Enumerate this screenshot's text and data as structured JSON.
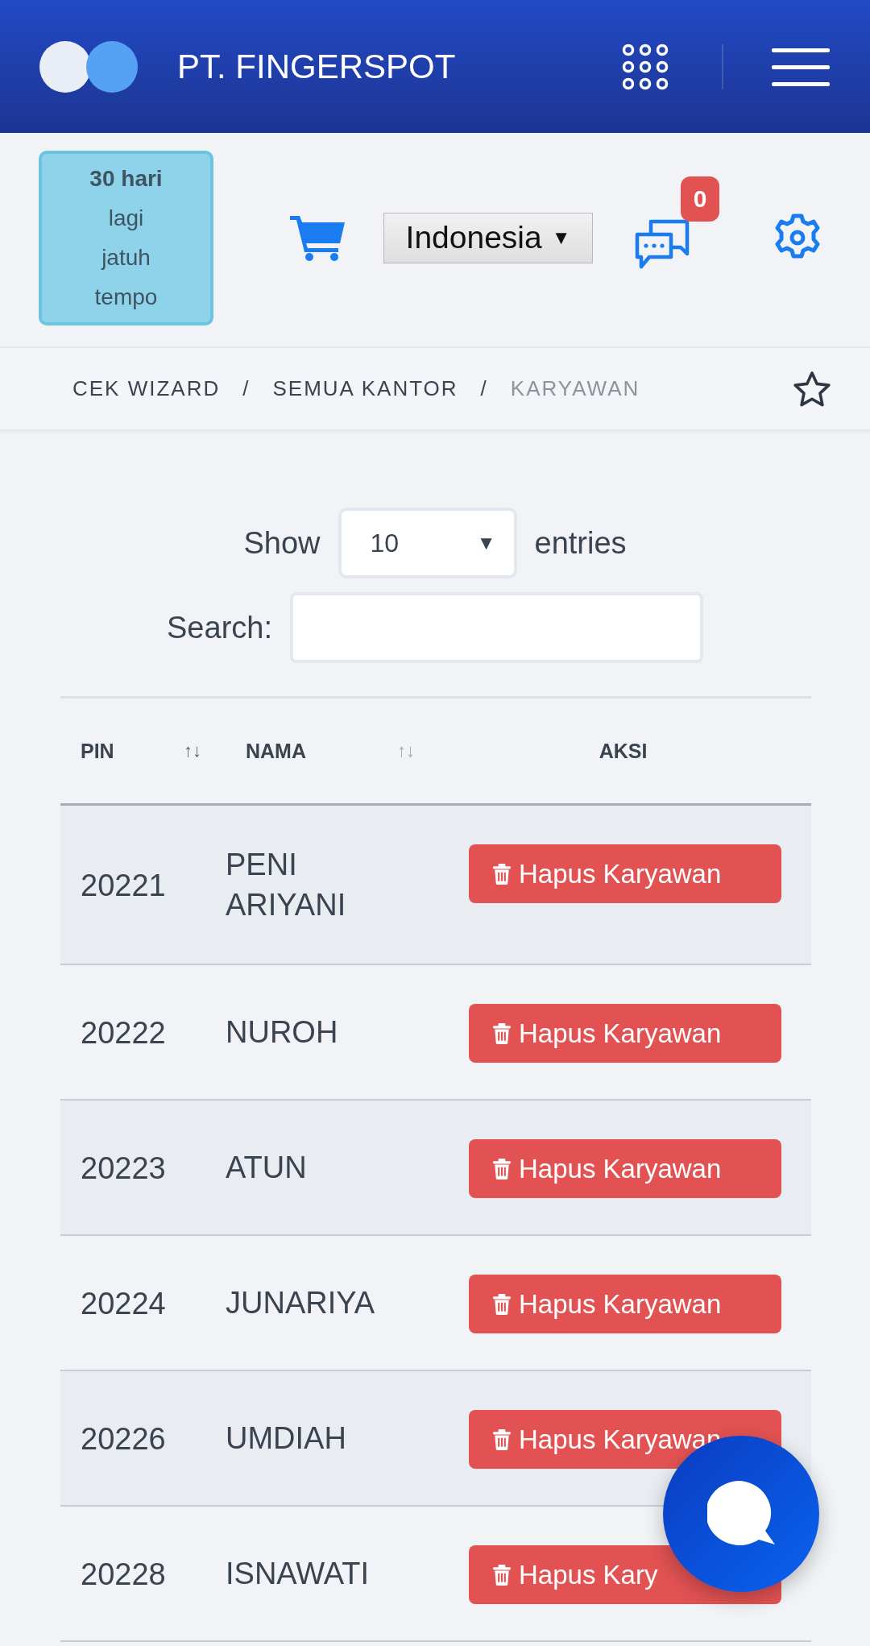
{
  "header": {
    "title": "PT. FINGERSPOT"
  },
  "due_notice": {
    "title": "30 hari",
    "text": "lagi jatuh tempo"
  },
  "language": {
    "value": "Indonesia",
    "caret": "▼"
  },
  "messages": {
    "count": "0"
  },
  "breadcrumb": [
    {
      "kind": "link",
      "label": "CEK WIZARD"
    },
    {
      "kind": "separator",
      "label": "/"
    },
    {
      "kind": "link",
      "label": "SEMUA KANTOR"
    },
    {
      "kind": "separator",
      "label": "/"
    },
    {
      "kind": "current",
      "label": "KARYAWAN"
    }
  ],
  "length_menu": {
    "label_before": "Show",
    "value": "10",
    "caret": "▼",
    "label_after": "entries"
  },
  "search": {
    "label": "Search:"
  },
  "table": {
    "columns": [
      {
        "label": "PIN",
        "sort_icon": "↑↓",
        "sorted": true
      },
      {
        "label": "NAMA",
        "sort_icon": "↑↓",
        "sorted": false
      },
      {
        "label": "AKSI"
      }
    ],
    "rows": [
      {
        "pin": "20221",
        "name": "PENI ARIYANI",
        "action": "Hapus Karyawan"
      },
      {
        "pin": "20222",
        "name": "NUROH",
        "action": "Hapus Karyawan"
      },
      {
        "pin": "20223",
        "name": "ATUN",
        "action": "Hapus Karyawan"
      },
      {
        "pin": "20224",
        "name": "JUNARIYA",
        "action": "Hapus Karyawan"
      },
      {
        "pin": "20226",
        "name": "UMDIAH",
        "action": "Hapus Karyawan"
      },
      {
        "pin": "20228",
        "name": "ISNAWATI",
        "action": "Hapus Kary"
      }
    ]
  }
}
